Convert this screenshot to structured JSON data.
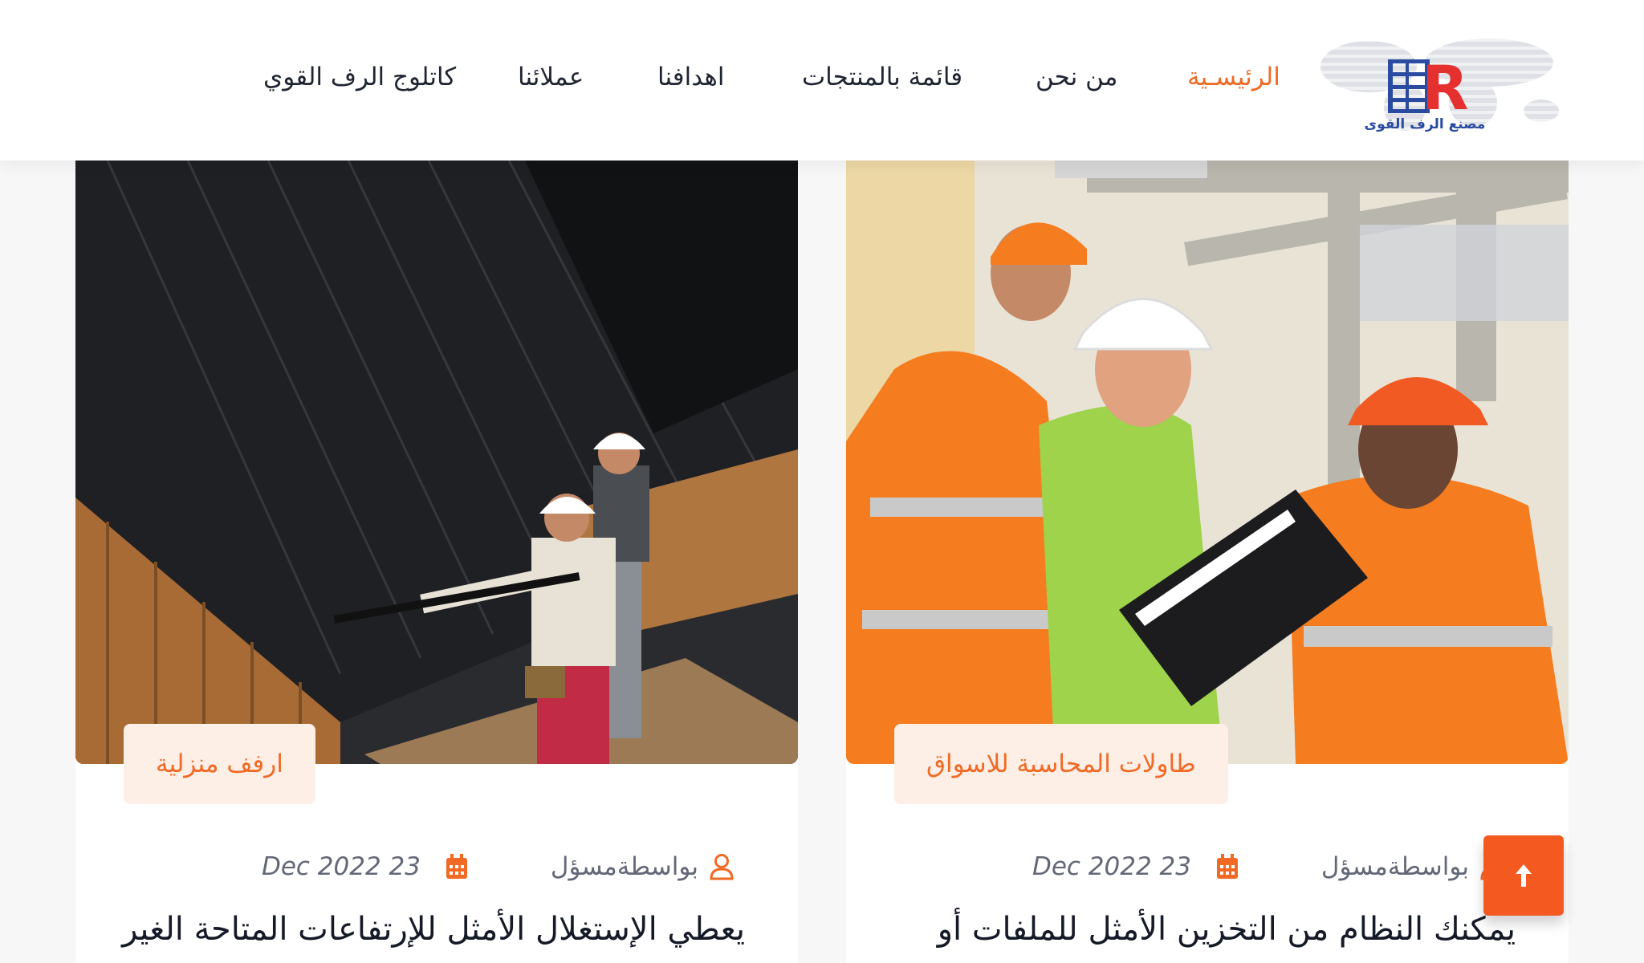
{
  "header": {
    "logo_text": "مصنع الرف القوى",
    "nav": [
      {
        "label": "الرئيسـية",
        "active": true
      },
      {
        "label": "من نحن",
        "active": false
      },
      {
        "label": "قائمة بالمنتجات",
        "active": false
      },
      {
        "label": "اهدافنا",
        "active": false
      },
      {
        "label": "عملائنا",
        "active": false
      },
      {
        "label": "كاتلوج الرف القوي",
        "active": false
      }
    ]
  },
  "posts": [
    {
      "image": "workers-in-hard-hats-reviewing-clipboard",
      "tag": "طاولات المحاسبة للاسواق",
      "author": "بواسطةمسؤل",
      "date": "Dec 2022 23",
      "title": "يمكنك النظام من التخزين الأمثل للملفات أو"
    },
    {
      "image": "roofers-on-dark-metal-roof",
      "tag": "ارفف منزلية",
      "author": "بواسطةمسؤل",
      "date": "Dec 2022 23",
      "title": "يعطي الإستغلال الأمثل للإرتفاعات المتاحة الغير"
    }
  ],
  "icons": {
    "author": "user-icon",
    "date": "calendar-icon",
    "scroll": "arrow-up-icon"
  },
  "colors": {
    "accent": "#f06a25",
    "tag_bg": "#fdeee6",
    "scroll_btn": "#f45a1f",
    "text": "#1f2433"
  }
}
